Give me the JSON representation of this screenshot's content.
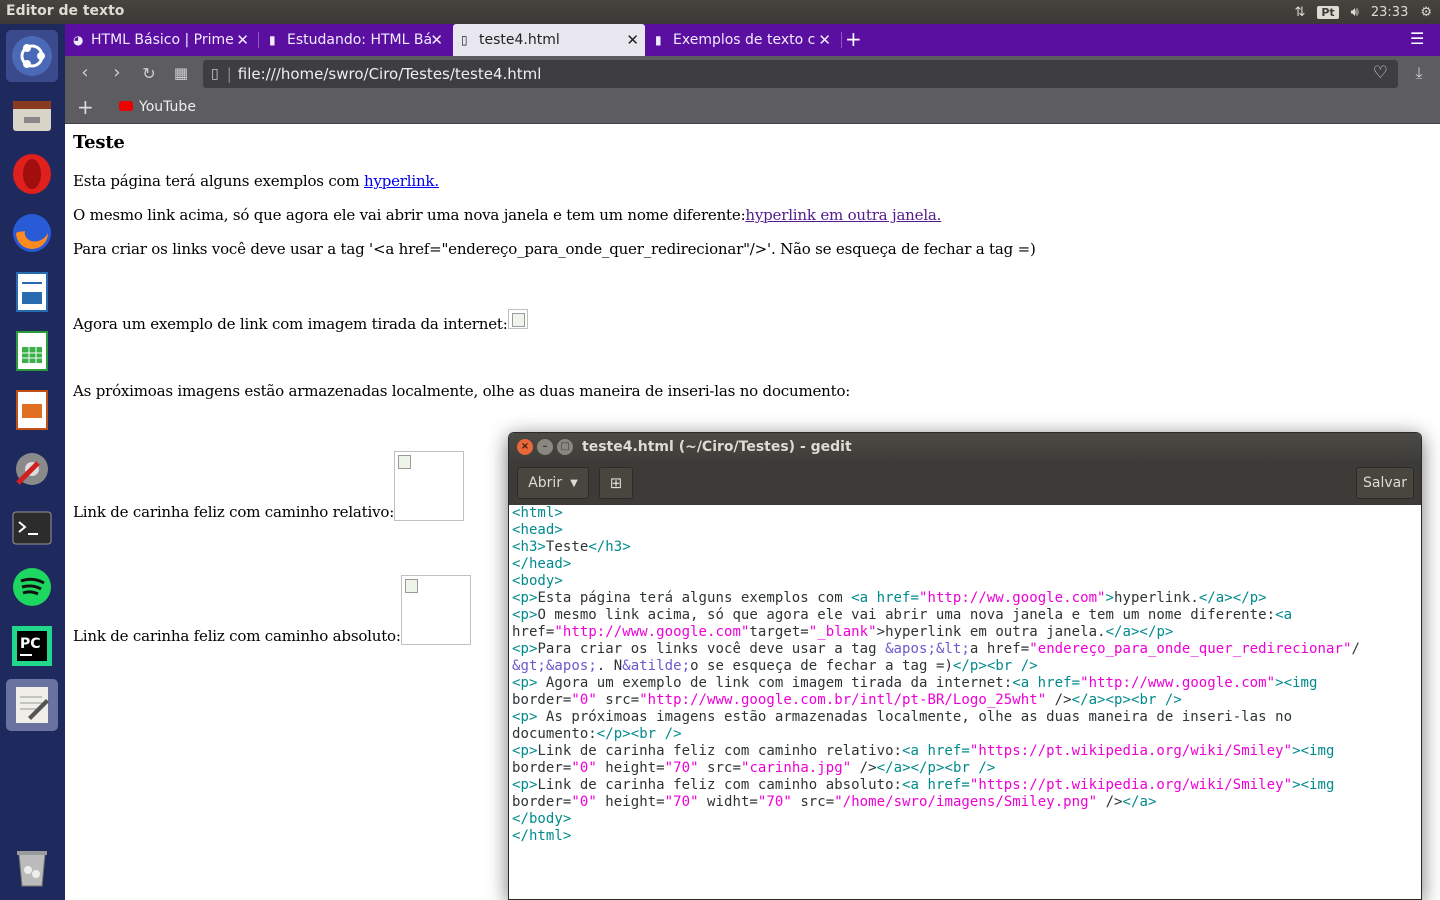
{
  "topbar": {
    "title": "Editor de texto",
    "kbd": "Pt",
    "time": "23:33"
  },
  "launcher": {
    "items": [
      "ubuntu-dash",
      "files",
      "opera",
      "firefox",
      "libreoffice-writer",
      "libreoffice-calc",
      "libreoffice-impress",
      "system-settings",
      "terminal",
      "spotify",
      "pycharm",
      "text-editor",
      "trash"
    ]
  },
  "browser": {
    "tabs": [
      {
        "label": "HTML Básico | Prime",
        "close": "✕"
      },
      {
        "label": "Estudando: HTML Bá",
        "close": "✕"
      },
      {
        "label": "teste4.html",
        "close": "✕"
      },
      {
        "label": "Exemplos de texto c",
        "close": "✕"
      }
    ],
    "new_tab": "+",
    "url": "file:///home/swro/Ciro/Testes/teste4.html",
    "bookmarks": [
      {
        "label": "YouTube"
      }
    ]
  },
  "page": {
    "heading": "Teste",
    "p1_text": "Esta página terá alguns exemplos com ",
    "p1_link": "hyperlink.",
    "p2_text": "O mesmo link acima, só que agora ele vai abrir uma nova janela e tem um nome diferente:",
    "p2_link": "hyperlink em outra janela.",
    "p3_text": "Para criar os links você deve usar a tag '<a href=\"endereço_para_onde_quer_redirecionar\"/>'. Não se esqueça de fechar a tag =)",
    "p4_text": "Agora um exemplo de link com imagem tirada da internet:",
    "p5_text": "As próximoas imagens estão armazenadas localmente, olhe as duas maneira de inseri-las no documento:",
    "p6_text": "Link de carinha feliz com caminho relativo:",
    "p7_text": "Link de carinha feliz com caminho absoluto:"
  },
  "gedit": {
    "title": "teste4.html (~/Ciro/Testes) - gedit",
    "open_label": "Abrir",
    "save_label": "Salvar",
    "lines": [
      "<html>",
      "<head>",
      "<h3>Teste</h3>",
      "</head>",
      "<body>",
      "<p>Esta página terá alguns exemplos com <a href=\"http://ww.google.com\">hyperlink.</a></p>",
      "<p>O mesmo link acima, só que agora ele vai abrir uma nova janela e tem um nome diferente:<a",
      "href=\"http://www.google.com\"target=\"_blank\">hyperlink em outra janela.</a></p>",
      "<p>Para criar os links você deve usar a tag &apos;&lt;a href=\"endereço_para_onde_quer_redirecionar\"/",
      "&gt;&apos;. N&atilde;o se esqueça de fechar a tag =)</p><br />",
      "<p> Agora um exemplo de link com imagem tirada da internet:<a href=\"http://www.google.com\"><img",
      "border=\"0\" src=\"http://www.google.com.br/intl/pt-BR/Logo_25wht\" /></a><p><br />",
      "<p> As próximoas imagens estão armazenadas localmente, olhe as duas maneira de inseri-las no",
      "documento:</p><br />",
      "<p>Link de carinha feliz com caminho relativo:<a href=\"https://pt.wikipedia.org/wiki/Smiley\"><img",
      "border=\"0\" height=\"70\" src=\"carinha.jpg\" /></a></p><br />",
      "<p>Link de carinha feliz com caminho absoluto:<a href=\"https://pt.wikipedia.org/wiki/Smiley\"><img",
      "border=\"0\" height=\"70\" widht=\"70\" src=\"/home/swro/imagens/Smiley.png\" /></a>",
      "</body>",
      "</html>"
    ]
  },
  "colors": {
    "tag": "#008a8c",
    "string": "#ee00d6",
    "entity": "#6a5acd",
    "tabbar": "#5a0fa0",
    "launcher": "#1e2a5e"
  }
}
